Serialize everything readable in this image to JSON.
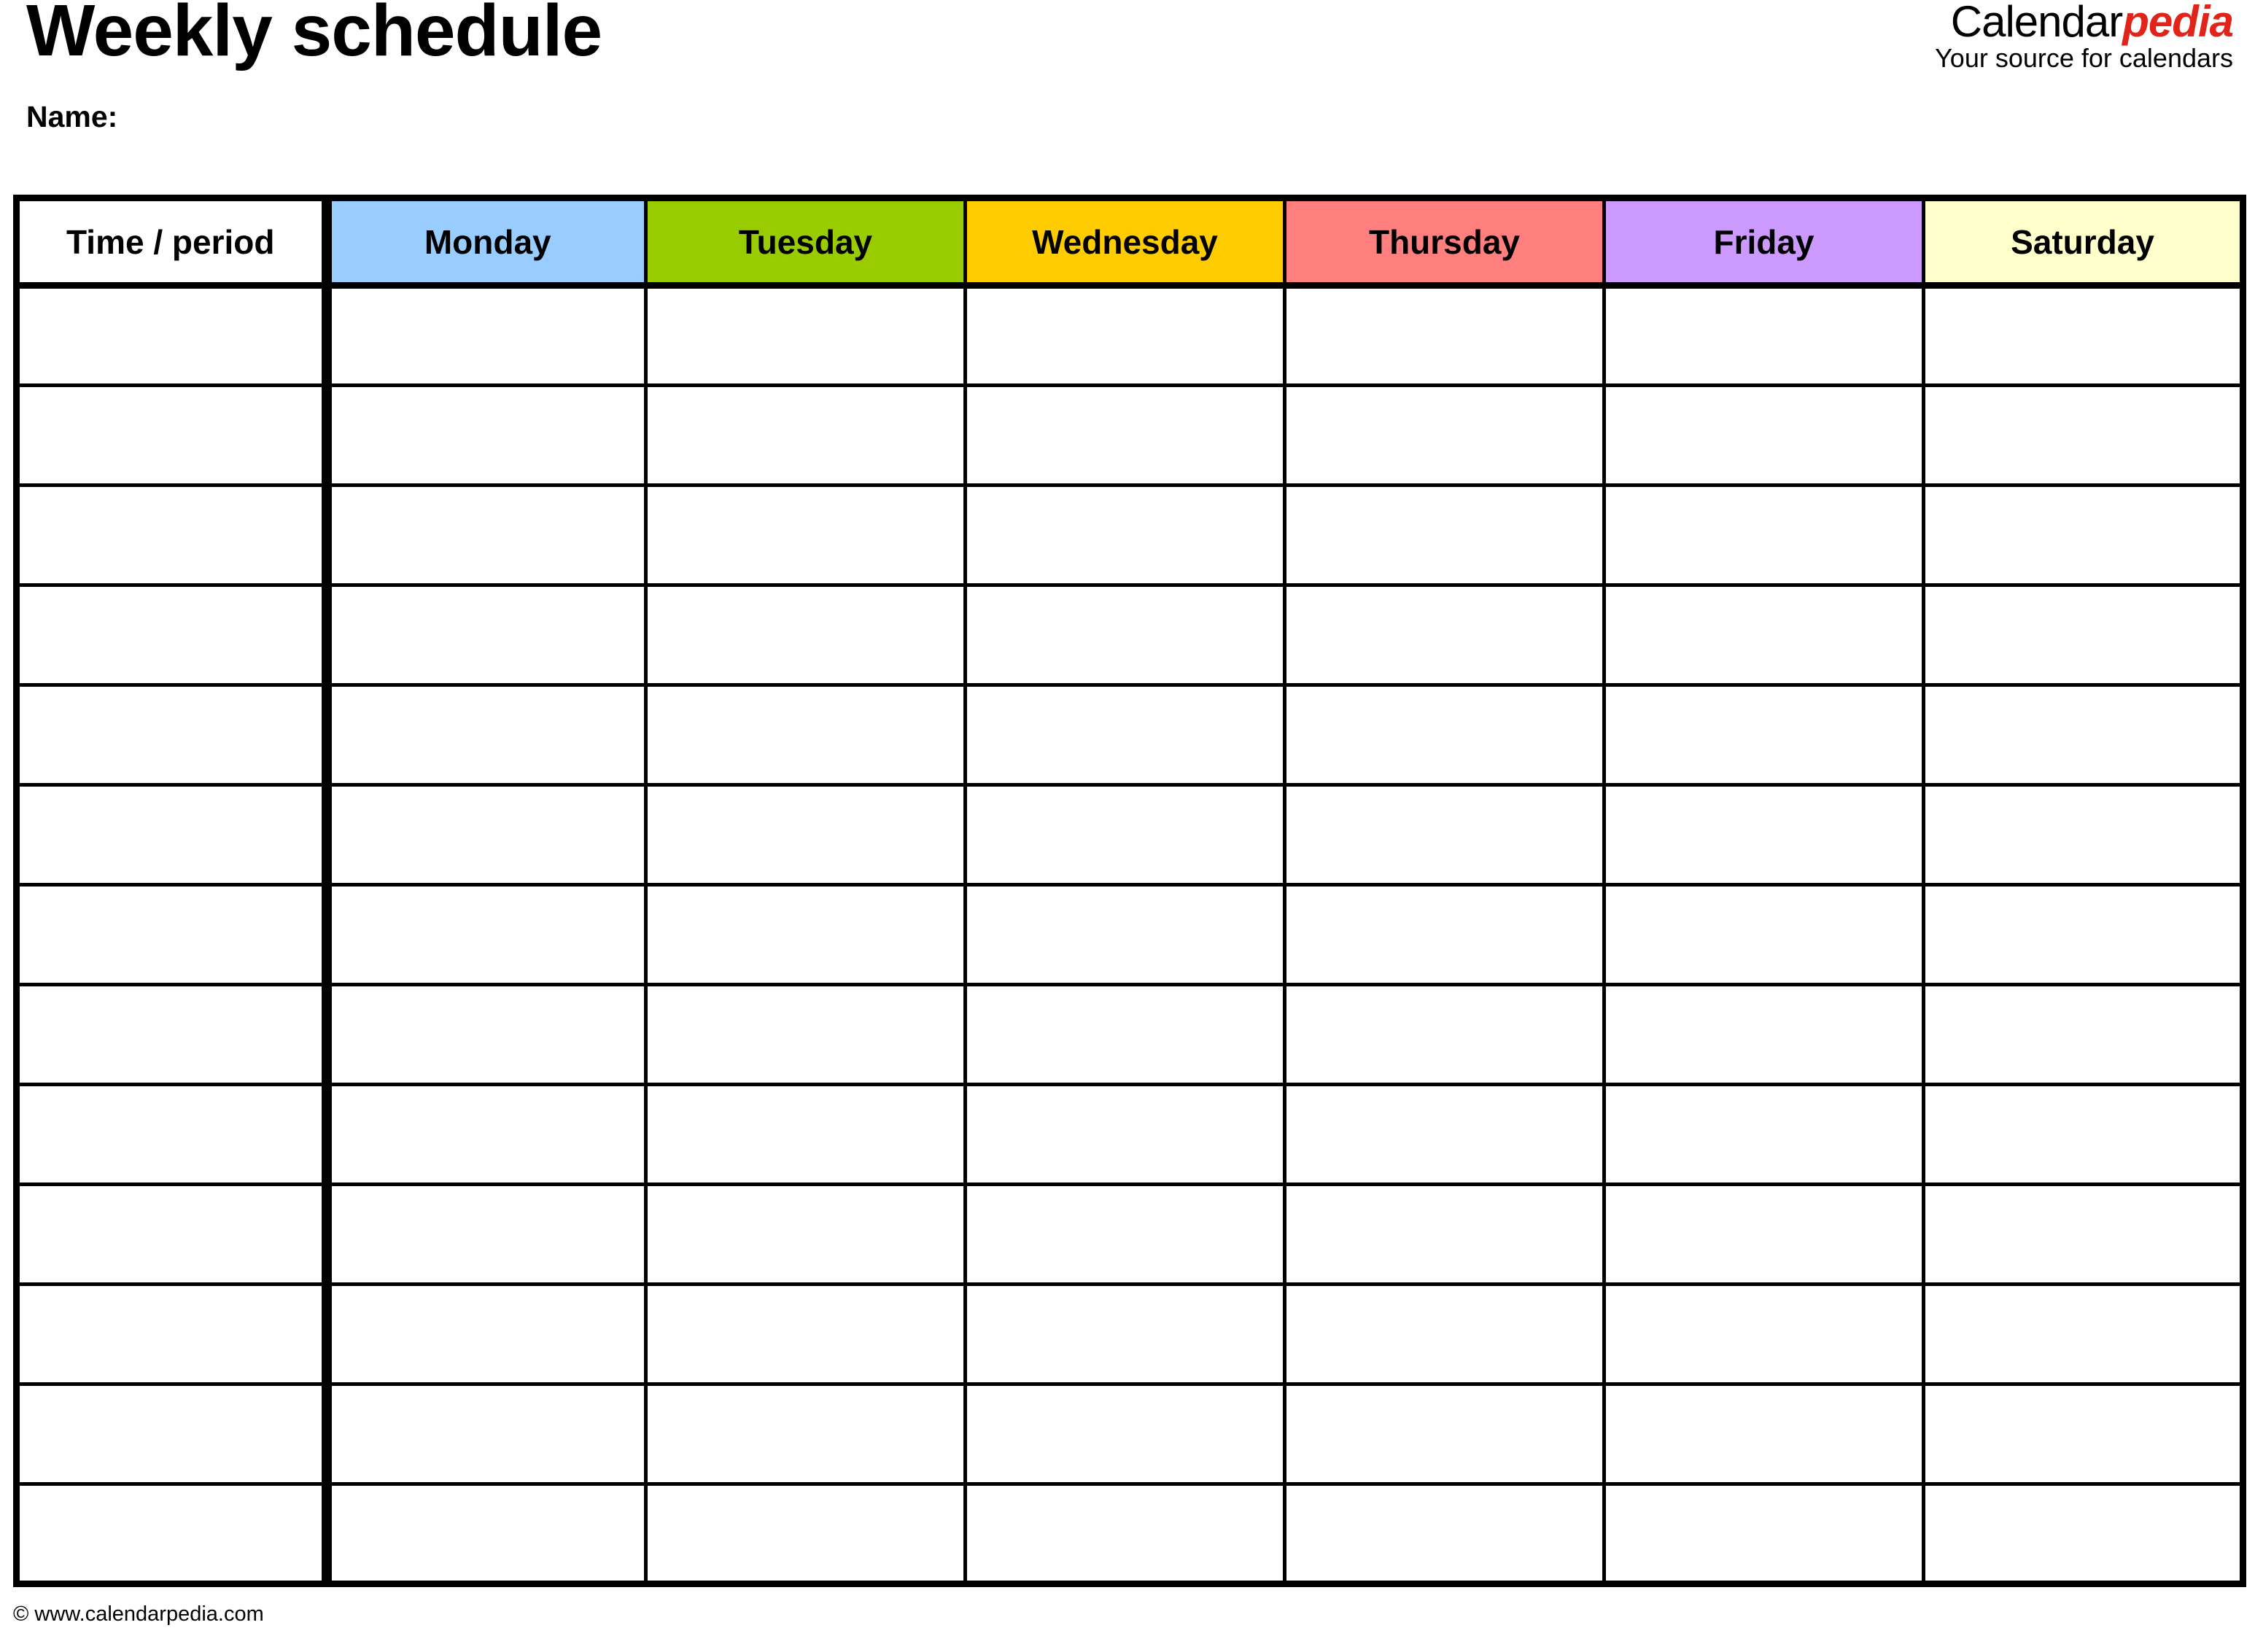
{
  "document": {
    "title": "Weekly schedule",
    "name_label": "Name:"
  },
  "brand": {
    "name_part1": "Calendar",
    "name_part2": "pedia",
    "tagline": "Your source for calendars",
    "accent_color": "#e2231a"
  },
  "table": {
    "columns": [
      {
        "label": "Time / period",
        "bg": "#ffffff"
      },
      {
        "label": "Monday",
        "bg": "#99ccff"
      },
      {
        "label": "Tuesday",
        "bg": "#99cc00"
      },
      {
        "label": "Wednesday",
        "bg": "#ffcc00"
      },
      {
        "label": "Thursday",
        "bg": "#ff7f7f"
      },
      {
        "label": "Friday",
        "bg": "#cc99ff"
      },
      {
        "label": "Saturday",
        "bg": "#ffffcc"
      }
    ],
    "row_count": 13,
    "rows": [
      [
        "",
        "",
        "",
        "",
        "",
        "",
        ""
      ],
      [
        "",
        "",
        "",
        "",
        "",
        "",
        ""
      ],
      [
        "",
        "",
        "",
        "",
        "",
        "",
        ""
      ],
      [
        "",
        "",
        "",
        "",
        "",
        "",
        ""
      ],
      [
        "",
        "",
        "",
        "",
        "",
        "",
        ""
      ],
      [
        "",
        "",
        "",
        "",
        "",
        "",
        ""
      ],
      [
        "",
        "",
        "",
        "",
        "",
        "",
        ""
      ],
      [
        "",
        "",
        "",
        "",
        "",
        "",
        ""
      ],
      [
        "",
        "",
        "",
        "",
        "",
        "",
        ""
      ],
      [
        "",
        "",
        "",
        "",
        "",
        "",
        ""
      ],
      [
        "",
        "",
        "",
        "",
        "",
        "",
        ""
      ],
      [
        "",
        "",
        "",
        "",
        "",
        "",
        ""
      ],
      [
        "",
        "",
        "",
        "",
        "",
        "",
        ""
      ]
    ]
  },
  "footer": {
    "copyright": "© www.calendarpedia.com"
  }
}
